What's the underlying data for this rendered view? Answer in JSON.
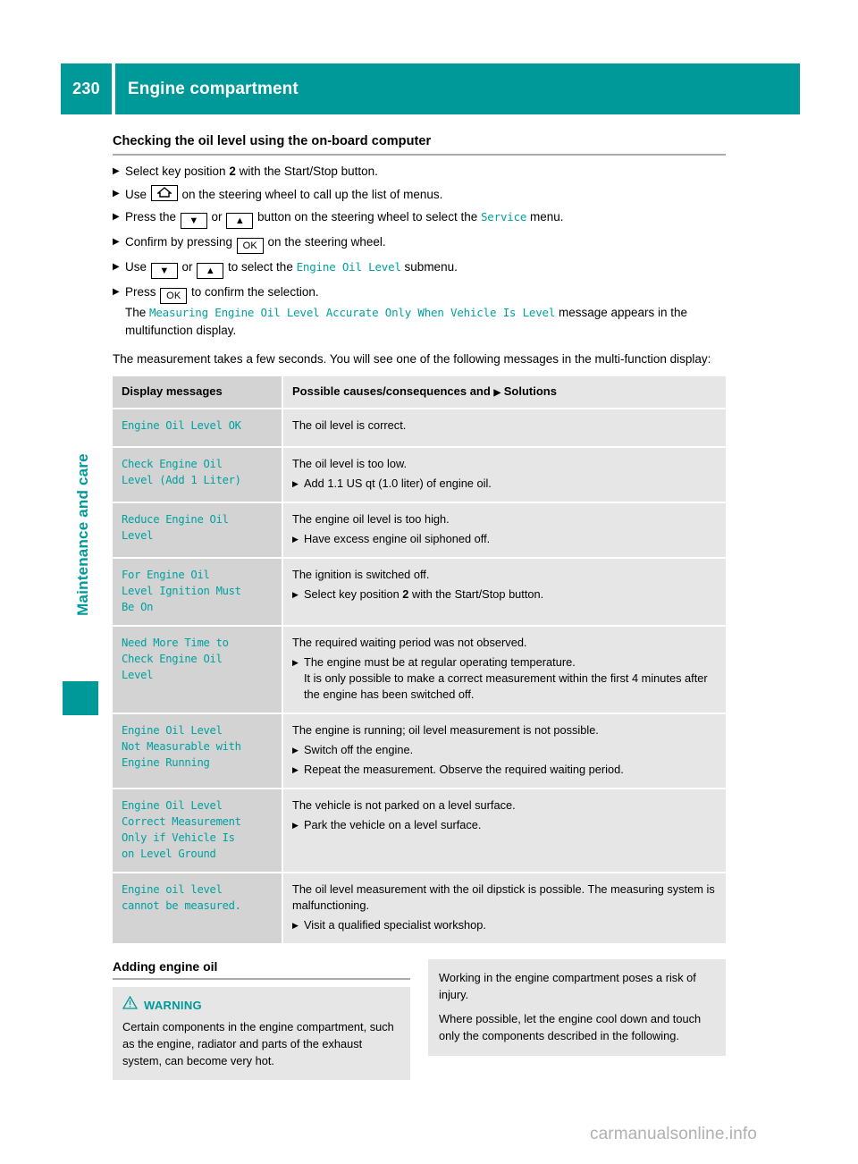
{
  "header": {
    "page_number": "230",
    "title": "Engine compartment"
  },
  "sidebar": {
    "chapter_label": "Maintenance and care"
  },
  "section": {
    "title": "Checking the oil level using the on-board computer"
  },
  "steps": [
    {
      "bullet": "▶",
      "pre": "Select key position ",
      "bold": "2",
      "post": " with the Start/Stop button."
    },
    {
      "bullet": "▶",
      "pre": "Use ",
      "key": "home-icon",
      "post": " on the steering wheel to call up the list of menus."
    },
    {
      "bullet": "▶",
      "pre": "Press the ",
      "key1": "▼",
      "mid": " or ",
      "key2": "▲",
      "post1": " button on the steering wheel to select the ",
      "mono": "Service",
      "post2": " menu."
    },
    {
      "bullet": "▶",
      "pre": "Confirm by pressing ",
      "key": "OK",
      "post": " on the steering wheel."
    },
    {
      "bullet": "▶",
      "pre": "Use ",
      "key1": "▼",
      "mid": " or ",
      "key2": "▲",
      "post1": " to select the ",
      "mono": "Engine Oil Level",
      "post2": " submenu."
    },
    {
      "bullet": "▶",
      "pre": "Press ",
      "key": "OK",
      "post": " to confirm the selection.",
      "note_pre": "The ",
      "note_mono": "Measuring Engine Oil Level Accurate Only When Vehicle Is Level",
      "note_post": " message appears in the multifunction display."
    }
  ],
  "intro_paragraph": "The measurement takes a few seconds. You will see one of the following messages in the multi-function display:",
  "table": {
    "headers": {
      "col1": "Display messages",
      "col2_pre": "Possible causes/consequences and ",
      "col2_bullet": "▶",
      "col2_post": " Solutions"
    },
    "rows": [
      {
        "message": "Engine Oil Level OK",
        "cause": "The oil level is correct.",
        "solutions": []
      },
      {
        "message": "Check Engine Oil\nLevel (Add 1 Liter)",
        "cause": "The oil level is too low.",
        "solutions": [
          "Add 1.1 US qt (1.0 liter) of engine oil."
        ]
      },
      {
        "message": "Reduce Engine Oil\nLevel",
        "cause": "The engine oil level is too high.",
        "solutions": [
          "Have excess engine oil siphoned off."
        ]
      },
      {
        "message": "For Engine Oil\nLevel Ignition Must\nBe On",
        "cause": "The ignition is switched off.",
        "solutions": [
          "Select key position 2 with the Start/Stop button."
        ],
        "solution_bold": "2"
      },
      {
        "message": "Need More Time to\nCheck Engine Oil\nLevel",
        "cause": "The required waiting period was not observed.",
        "solutions": [
          "The engine must be at regular operating temperature."
        ],
        "extra": "It is only possible to make a correct measurement within the first 4 minutes after the engine has been switched off."
      },
      {
        "message": "Engine Oil Level\nNot Measurable with\nEngine Running",
        "cause": "The engine is running; oil level measurement is not possible.",
        "solutions": [
          "Switch off the engine.",
          "Repeat the measurement. Observe the required waiting period."
        ]
      },
      {
        "message": "Engine Oil Level\nCorrect Measurement\nOnly if Vehicle Is\non Level Ground",
        "cause": "The vehicle is not parked on a level surface.",
        "solutions": [
          "Park the vehicle on a level surface."
        ]
      },
      {
        "message": "Engine oil level\ncannot be measured.",
        "cause": "The oil level measurement with the oil dipstick is possible. The measuring system is malfunctioning.",
        "solutions": [
          "Visit a qualified specialist workshop."
        ]
      }
    ]
  },
  "bottom": {
    "sub_title": "Adding engine oil",
    "warning_label": "WARNING",
    "warning_body": "Certain components in the engine compartment, such as the engine, radiator and parts of the exhaust system, can become very hot.",
    "continuation_1": "Working in the engine compartment poses a risk of injury.",
    "continuation_2": "Where possible, let the engine cool down and touch only the components described in the following."
  },
  "watermark": "carmanualsonline.info",
  "colors": {
    "teal": "#009999",
    "mono_teal": "#00a0a0",
    "table_col1_bg": "#d3d3d3",
    "table_col2_bg": "#e6e6e6"
  }
}
